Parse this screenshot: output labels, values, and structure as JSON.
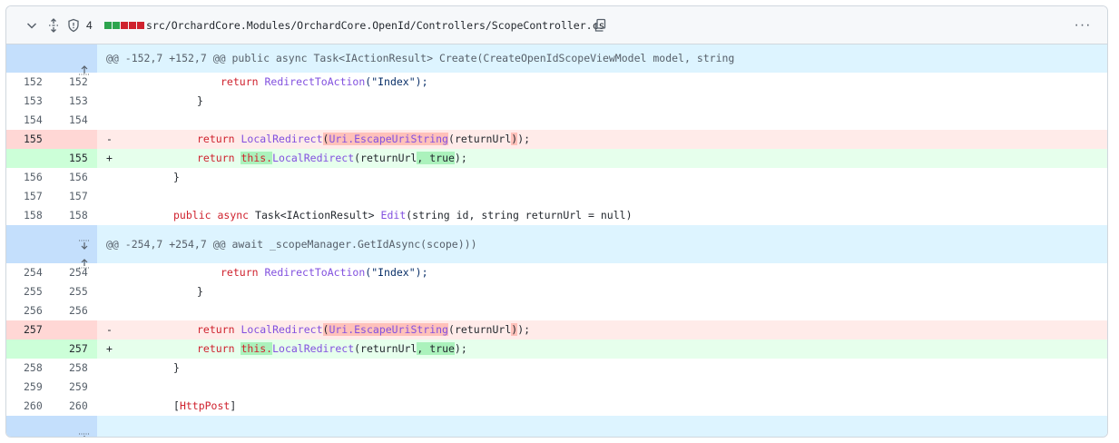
{
  "file": {
    "changes_count": "4",
    "path": "src/OrchardCore.Modules/OrchardCore.OpenId/Controllers/ScopeController.cs",
    "diffstat_colors": [
      "#2da44e",
      "#2da44e",
      "#cf222e",
      "#cf222e",
      "#cf222e"
    ],
    "more_label": "···"
  },
  "hunks": {
    "h1": "@@ -152,7 +152,7 @@ public async Task<IActionResult> Create(CreateOpenIdScopeViewModel model, string",
    "h2": "@@ -254,7 +254,7 @@ await _scopeManager.GetIdAsync(scope)))"
  },
  "lines": {
    "r1": {
      "l": "152",
      "r": "152"
    },
    "r2": {
      "l": "153",
      "r": "153"
    },
    "r3": {
      "l": "154",
      "r": "154"
    },
    "r4": {
      "l": "155",
      "r": "",
      "sign": "-"
    },
    "r5": {
      "l": "",
      "r": "155",
      "sign": "+"
    },
    "r6": {
      "l": "156",
      "r": "156"
    },
    "r7": {
      "l": "157",
      "r": "157"
    },
    "r8": {
      "l": "158",
      "r": "158"
    },
    "r9": {
      "l": "254",
      "r": "254"
    },
    "r10": {
      "l": "255",
      "r": "255"
    },
    "r11": {
      "l": "256",
      "r": "256"
    },
    "r12": {
      "l": "257",
      "r": "",
      "sign": "-"
    },
    "r13": {
      "l": "",
      "r": "257",
      "sign": "+"
    },
    "r14": {
      "l": "258",
      "r": "258"
    },
    "r15": {
      "l": "259",
      "r": "259"
    },
    "r16": {
      "l": "260",
      "r": "260"
    }
  },
  "tokens": {
    "ret": "return",
    "redirect": "RedirectToAction",
    "index": "(\"Index\");",
    "brace": "}",
    "local": "LocalRedirect",
    "popen": "(",
    "uri": "Uri.EscapeUriString",
    "ret_url": "returnUrl",
    "pclose": ");",
    "pclose_hl": ")",
    "semi": ";",
    "this": "this.",
    "ret_url_comma": "(returnUrl",
    "comma_true": ", true",
    "true_close": ");",
    "public": "public",
    "async": "async",
    "task": "Task<IActionResult>",
    "edit": "Edit",
    "sig": "(string id, string returnUrl = null)",
    "attr_open": "[",
    "httppost": "HttpPost",
    "attr_close": "]"
  }
}
